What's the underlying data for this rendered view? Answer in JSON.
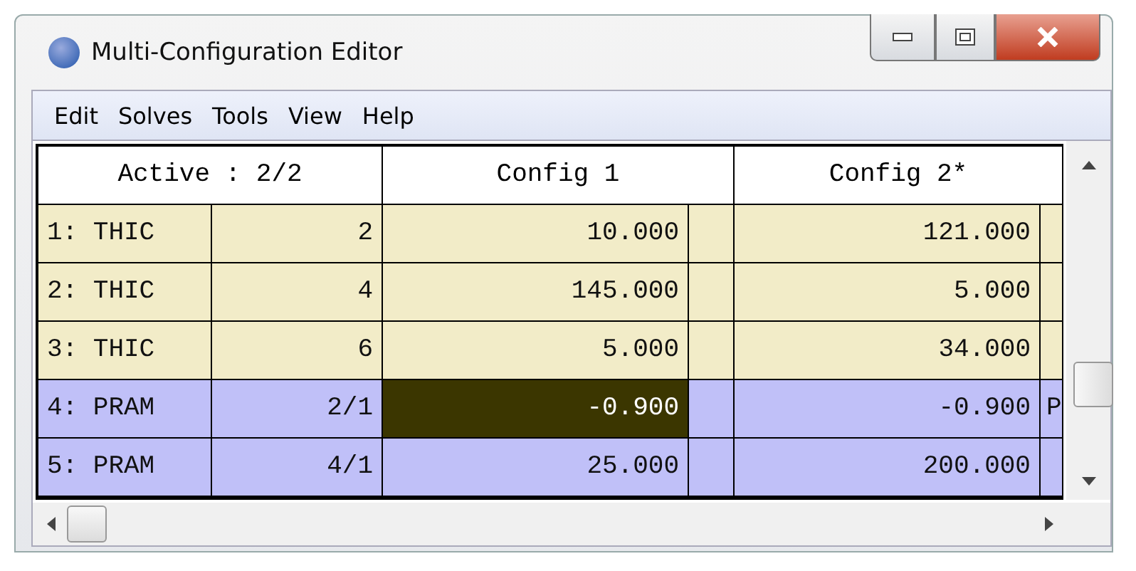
{
  "window": {
    "title": "Multi-Configuration Editor"
  },
  "menu": [
    "Edit",
    "Solves",
    "Tools",
    "View",
    "Help"
  ],
  "header": {
    "active": "Active : 2/2",
    "configs": [
      "Config 1",
      "Config 2*"
    ]
  },
  "rows": [
    {
      "operand": "1: THIC",
      "param": "2",
      "kind": "thic",
      "cells": [
        {
          "value": "10.000",
          "selected": false
        },
        {
          "value": "121.000",
          "selected": false
        }
      ]
    },
    {
      "operand": "2: THIC",
      "param": "4",
      "kind": "thic",
      "cells": [
        {
          "value": "145.000",
          "selected": false
        },
        {
          "value": "5.000",
          "selected": false
        }
      ]
    },
    {
      "operand": "3: THIC",
      "param": "6",
      "kind": "thic",
      "cells": [
        {
          "value": "5.000",
          "selected": false
        },
        {
          "value": "34.000",
          "selected": false
        }
      ]
    },
    {
      "operand": "4: PRAM",
      "param": "2/1",
      "kind": "pram",
      "cells": [
        {
          "value": "-0.900",
          "selected": true
        },
        {
          "value": "-0.900",
          "flag": "P",
          "selected": false
        }
      ]
    },
    {
      "operand": "5: PRAM",
      "param": "4/1",
      "kind": "pram",
      "cells": [
        {
          "value": "25.000",
          "selected": false
        },
        {
          "value": "200.000",
          "selected": false
        }
      ]
    }
  ]
}
